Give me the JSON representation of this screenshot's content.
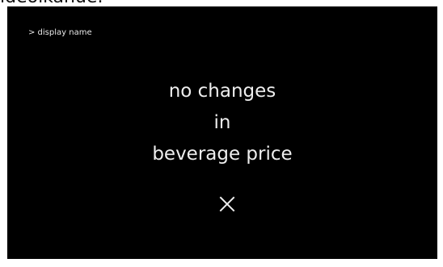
{
  "top_caption": "ideoikanue.",
  "screen": {
    "breadcrumb": "> display name",
    "message_lines": [
      "no changes",
      "in",
      "beverage price"
    ],
    "close_icon": "close-icon"
  },
  "colors": {
    "screen_background": "#000000",
    "text": "#eeeeee",
    "page_background": "#ffffff"
  }
}
